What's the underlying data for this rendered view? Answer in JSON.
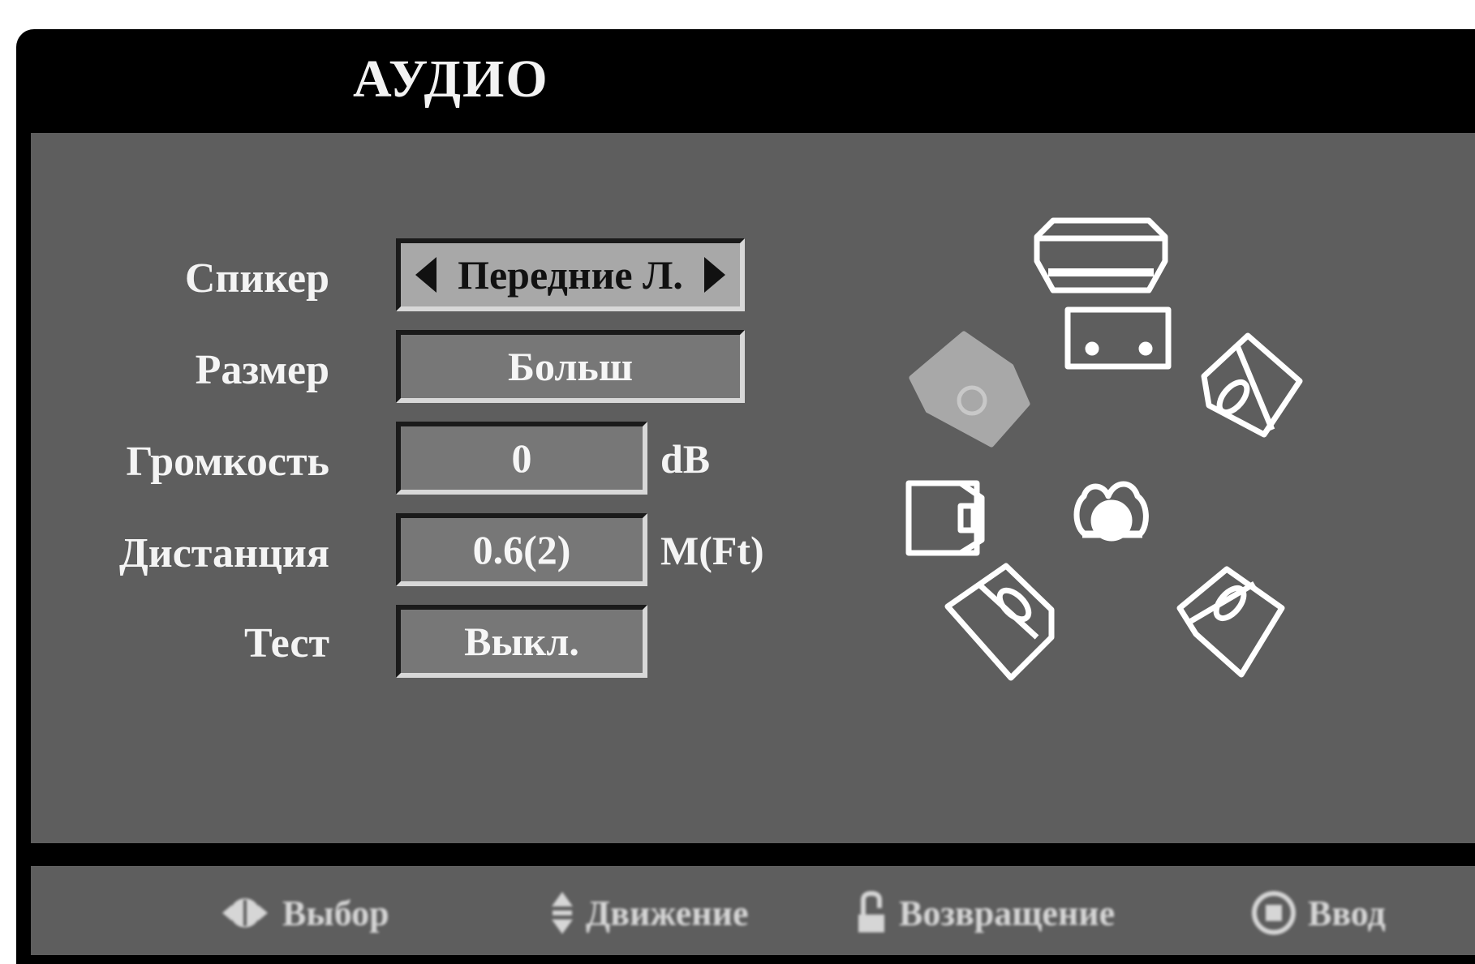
{
  "menu": {
    "title": "АУДИО"
  },
  "rows": {
    "speaker": {
      "label": "Спикер",
      "value": "Передние Л."
    },
    "size": {
      "label": "Размер",
      "value": "Больш"
    },
    "volume": {
      "label": "Громкость",
      "value": "0",
      "unit": "dB"
    },
    "distance": {
      "label": "Дистанция",
      "value": "0.6(2)",
      "unit": "M(Ft)"
    },
    "test": {
      "label": "Тест",
      "value": "Выкл."
    }
  },
  "speaker_diagram": {
    "highlighted": "front-left",
    "speakers": [
      "front-left",
      "center",
      "front-right",
      "subwoofer",
      "surround-left",
      "surround-right",
      "listener"
    ]
  },
  "footer": {
    "hints": [
      {
        "icon": "left-right-icon",
        "label": "Выбор"
      },
      {
        "icon": "up-down-icon",
        "label": "Движение"
      },
      {
        "icon": "return-icon",
        "label": "Возвращение"
      },
      {
        "icon": "enter-icon",
        "label": "Ввод"
      }
    ]
  },
  "colors": {
    "frame": "#000000",
    "panel": "#5e5e5e",
    "field": "#777777",
    "selected_field": "#a8a8a8",
    "highlighted_speaker": "#a8a8a8"
  }
}
